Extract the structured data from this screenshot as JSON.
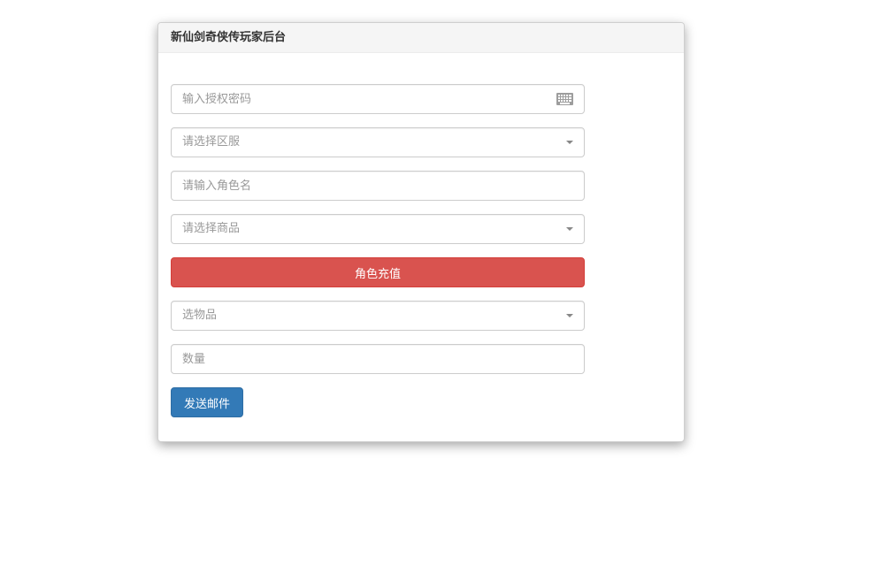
{
  "panel": {
    "title": "新仙剑奇侠传玩家后台"
  },
  "form": {
    "auth_password": {
      "placeholder": "输入授权密码",
      "icon": "keyboard-icon"
    },
    "server_select": {
      "placeholder": "请选择区服"
    },
    "role_name": {
      "placeholder": "请输入角色名"
    },
    "product_select": {
      "placeholder": "请选择商品"
    },
    "recharge_button": "角色充值",
    "item_select": {
      "placeholder": "选物品"
    },
    "quantity": {
      "placeholder": "数量"
    },
    "send_mail_button": "发送邮件"
  },
  "colors": {
    "recharge_button": "#d9534f",
    "send_button": "#337ab7",
    "panel_heading_bg": "#f5f5f5"
  }
}
